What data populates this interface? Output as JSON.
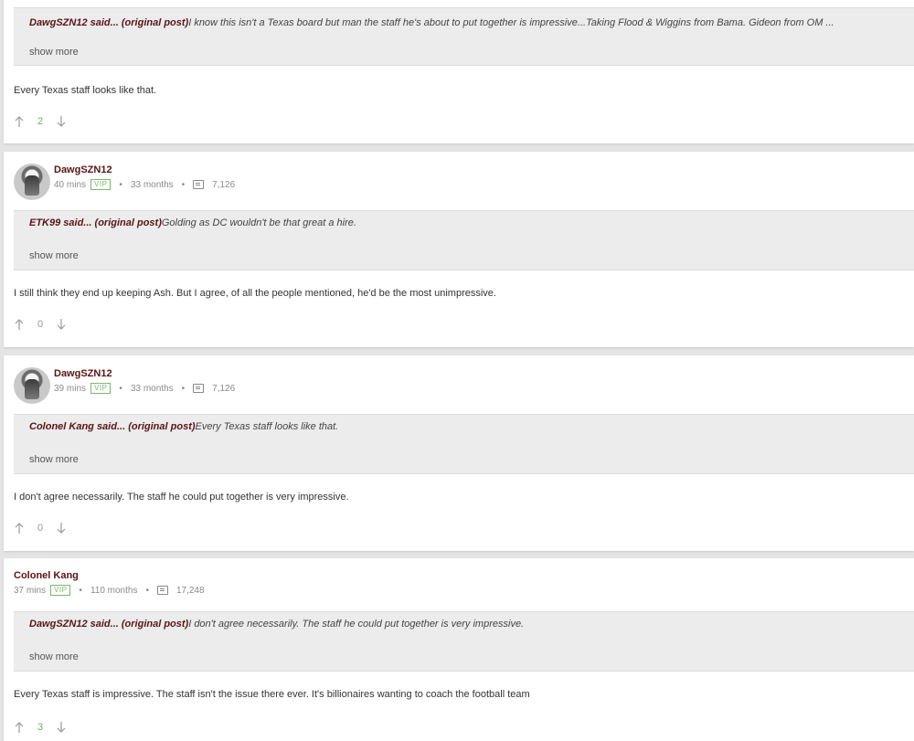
{
  "posts": [
    {
      "quote": {
        "author": "DawgSZN12 said...",
        "orig": "(original post)",
        "text": "I know this isn't a Texas board but man the staff he's about to put together is impressive...Taking Flood & Wiggins from Bama. Gideon from OM ..."
      },
      "show_more": "show more",
      "body": "Every Texas staff looks like that.",
      "votes": "2"
    },
    {
      "username": "DawgSZN12",
      "time": "40 mins",
      "vip": "VIP",
      "tenure": "33 months",
      "posts": "7,126",
      "quote": {
        "author": "ETK99 said...",
        "orig": "(original post)",
        "text": "Golding as DC wouldn't be that great a hire."
      },
      "show_more": "show more",
      "body": "I still think they end up keeping Ash. But I agree, of all the people mentioned, he'd be the most unimpressive.",
      "votes": "0"
    },
    {
      "username": "DawgSZN12",
      "time": "39 mins",
      "vip": "VIP",
      "tenure": "33 months",
      "posts": "7,126",
      "quote": {
        "author": "Colonel Kang said...",
        "orig": "(original post)",
        "text": "Every Texas staff looks like that."
      },
      "show_more": "show more",
      "body": "I don't agree necessarily. The staff he could put together is very impressive.",
      "votes": "0"
    },
    {
      "username": "Colonel Kang",
      "time": "37 mins",
      "vip": "VIP",
      "tenure": "110 months",
      "posts": "17,248",
      "quote": {
        "author": "DawgSZN12 said...",
        "orig": "(original post)",
        "text": "I don't agree necessarily. The staff he could put together is very impressive."
      },
      "show_more": "show more",
      "body": "Every Texas staff is impressive. The staff isn't the issue there ever. It's billionaires wanting to coach the football team",
      "votes": "3"
    }
  ],
  "icons": {
    "upvote": "arrow-up-icon",
    "downvote": "arrow-down-icon",
    "posts": "message-icon"
  },
  "colors": {
    "username": "#5a1414",
    "vip": "#7cb66d",
    "positive_vote": "#6bb35a"
  }
}
